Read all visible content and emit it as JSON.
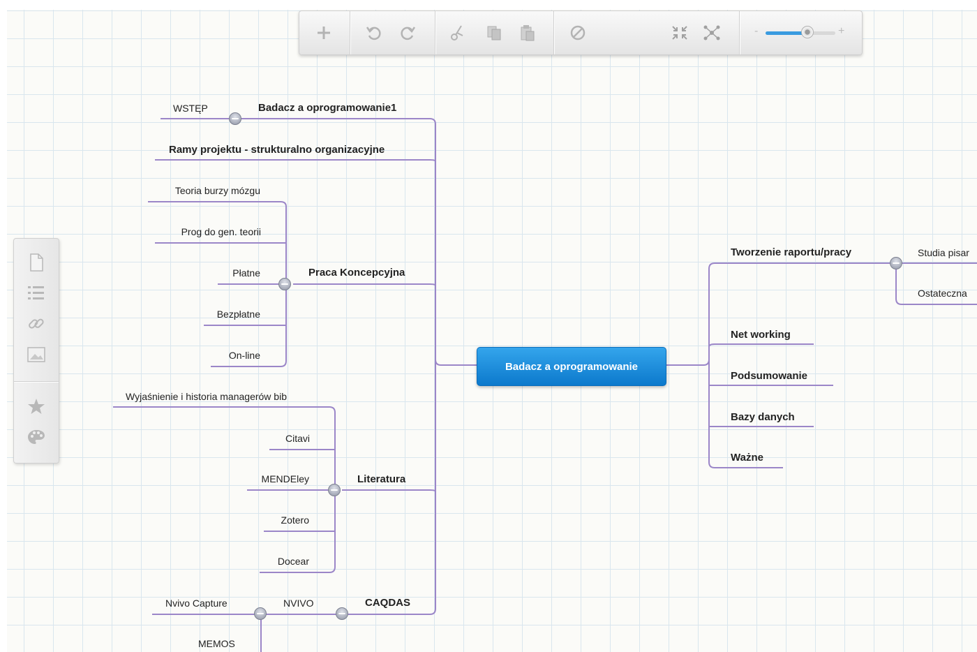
{
  "toolbar": {
    "add_icon": "plus-icon",
    "undo_icon": "undo-icon",
    "redo_icon": "redo-icon",
    "cut_icon": "scissors-icon",
    "copy_icon": "copy-icon",
    "paste_icon": "paste-icon",
    "delete_icon": "prohibited-icon",
    "collapse_all_icon": "collapse-all-icon",
    "layout_icon": "nodes-layout-icon",
    "zoom_minus": "-",
    "zoom_plus": "+",
    "zoom_level": 0.6
  },
  "sidebar": {
    "items": [
      "document-icon",
      "list-icon",
      "link-icon",
      "image-icon",
      "star-icon",
      "palette-icon"
    ]
  },
  "map": {
    "central": "Badacz a oprogramowanie",
    "left": {
      "badacz1": "Badacz a oprogramowanie1",
      "wstep": "WSTĘP",
      "ramy": "Ramy projektu - strukturalno organizacyjne",
      "praca": "Praca Koncepcyjna",
      "praca_children": [
        "Teoria burzy mózgu",
        "Prog do gen. teorii",
        "Płatne",
        "Bezpłatne",
        "On-line"
      ],
      "literatura": "Literatura",
      "literatura_children": [
        "Wyjaśnienie i historia managerów bib",
        "Citavi",
        "MENDEley",
        "Zotero",
        "Docear"
      ],
      "caqdas": "CAQDAS",
      "nvivo": "NVIVO",
      "nvivo_capture": "Nvivo Capture",
      "memos": "MEMOS"
    },
    "right": {
      "tworzenie": "Tworzenie raportu/pracy",
      "tworzenie_children": [
        "Studia pisar",
        "Ostateczna"
      ],
      "net": "Net working",
      "podsumowanie": "Podsumowanie",
      "bazy": "Bazy danych",
      "wazne": "Ważne"
    }
  },
  "colors": {
    "connector": "#9b86c8",
    "central_node": "#1a8ad8",
    "grid": "#d9e6ee"
  }
}
